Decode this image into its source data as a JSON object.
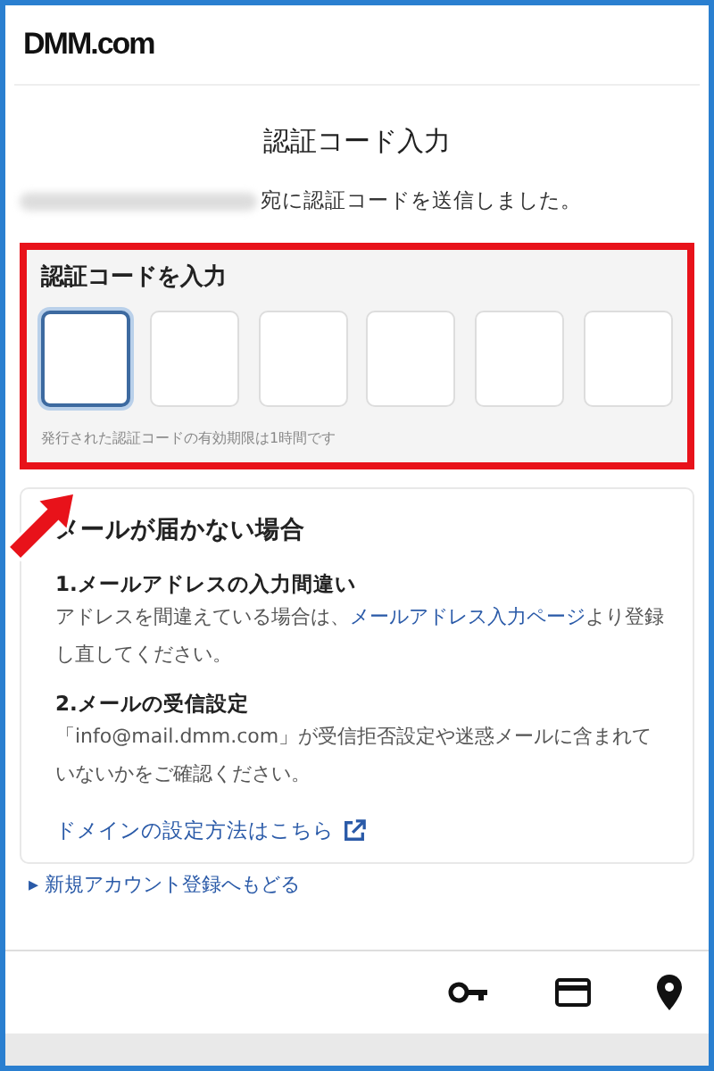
{
  "header": {
    "logo": "DMM.com"
  },
  "title": "認証コード入力",
  "sent_message": "宛に認証コードを送信しました。",
  "code_entry": {
    "label": "認証コードを入力",
    "boxes": [
      {
        "selected": true
      },
      {
        "selected": false
      },
      {
        "selected": false
      },
      {
        "selected": false
      },
      {
        "selected": false
      },
      {
        "selected": false
      }
    ],
    "note": "発行された認証コードの有効期限は1時間です"
  },
  "help": {
    "heading": "メールが届かない場合",
    "sections": [
      {
        "title": "1.メールアドレスの入力間違い",
        "text_before": "アドレスを間違えている場合は、",
        "link": "メールアドレス入力ページ",
        "text_after": "より登録し直してください。"
      },
      {
        "title": "2.メールの受信設定",
        "text_before": "「info@mail.dmm.com」が受信拒否設定や迷惑メールに含まれていないかをご確認ください。"
      }
    ],
    "domain_link": "ドメインの設定方法はこちら"
  },
  "back_link": "▸ 新規アカウント登録へもどる"
}
